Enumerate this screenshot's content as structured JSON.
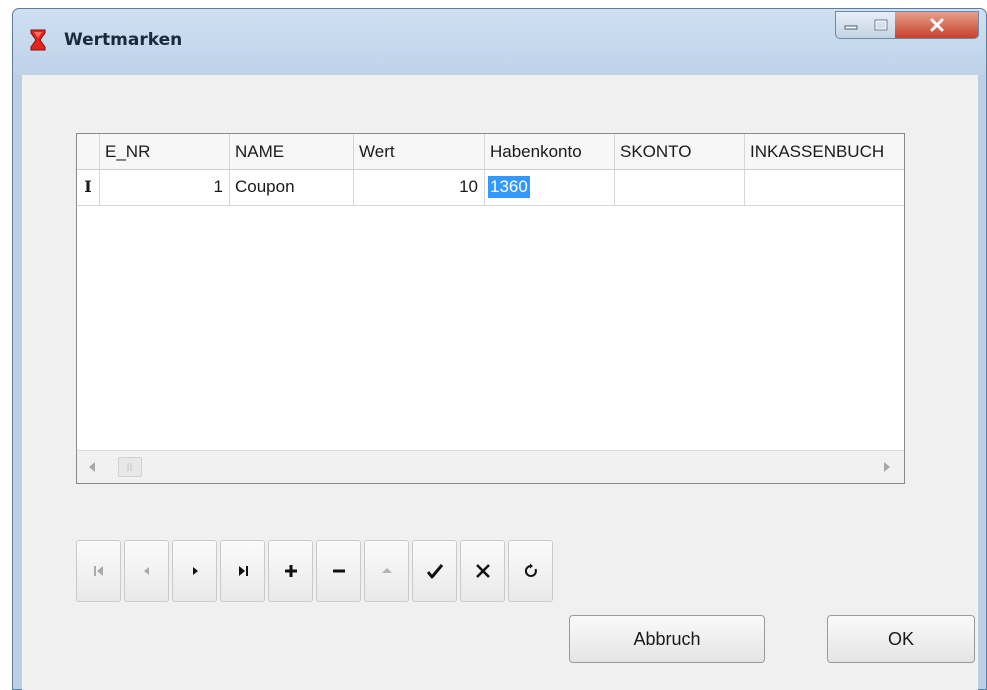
{
  "window": {
    "title": "Wertmarken",
    "icon": "red-hourglass-app-icon",
    "controls": [
      "minimize-icon",
      "maximize-icon",
      "close-icon"
    ]
  },
  "grid": {
    "columns": [
      "E_NR",
      "NAME",
      "Wert",
      "Habenkonto",
      "SKONTO",
      "INKASSENBUCH"
    ],
    "rows": [
      {
        "indicator": "I",
        "E_NR": "1",
        "NAME": "Coupon",
        "Wert": "10",
        "Habenkonto": "1360",
        "SKONTO": "",
        "INKASSENBUCH": ""
      }
    ],
    "scrollbar": {
      "left_icon": "arrow-left-icon",
      "right_icon": "arrow-right-icon"
    }
  },
  "navigator": {
    "buttons": [
      "first-icon",
      "prior-icon",
      "next-icon",
      "last-icon",
      "insert-icon",
      "delete-icon",
      "edit-icon",
      "post-icon",
      "cancel-icon",
      "refresh-icon"
    ]
  },
  "buttons": {
    "cancel": "Abbruch",
    "ok": "OK"
  },
  "colors": {
    "title_bar": "#bed2e8",
    "selection": "#3399ff",
    "close_button": "#c7402a"
  }
}
